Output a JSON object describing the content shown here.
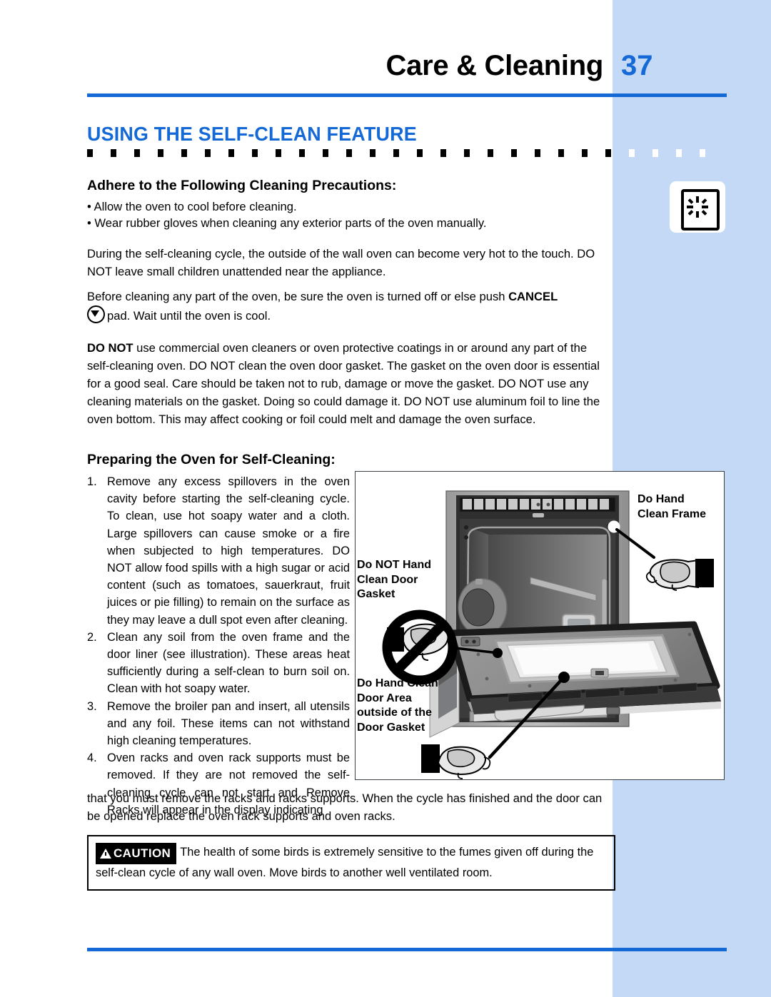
{
  "colors": {
    "accent_blue": "#1569d6",
    "band_blue": "#c4d9f5",
    "text_black": "#000000"
  },
  "header": {
    "title": "Care & Cleaning",
    "page_number": "37"
  },
  "section": {
    "heading": "USING THE SELF-CLEAN FEATURE"
  },
  "precautions": {
    "heading": "Adhere to the Following Cleaning Precautions:",
    "bullets": [
      "• Allow the oven to cool before cleaning.",
      "• Wear rubber gloves when cleaning any exterior parts of the oven manually."
    ]
  },
  "paragraphs": {
    "hot_surface": "During the self-cleaning cycle, the outside of the wall oven can become very hot to the touch. DO NOT leave small children unattended near the appliance.",
    "before_cleaning_lead": "Before cleaning any part of the oven, be sure the oven is turned off or else push ",
    "before_cleaning_bold": "CANCEL",
    "before_cleaning_tail": "pad. Wait until the oven is cool.",
    "do_not_bold": "DO NOT",
    "do_not_rest": " use commercial oven cleaners or oven protective coatings in or around any part of the self-cleaning oven. DO NOT clean the oven door gasket. The gasket on the oven door is essential for a good seal. Care should be taken not to rub, damage or move the gasket. DO NOT use any cleaning materials on the gasket. Doing so could damage it. DO NOT use aluminum foil to line the oven bottom. This may affect cooking or foil could melt and damage the oven surface."
  },
  "preparing": {
    "heading": "Preparing the Oven for Self-Cleaning:",
    "steps": [
      {
        "num": "1.",
        "text": "Remove any excess spillovers in the oven cavity before starting the self-cleaning cycle. To clean, use hot soapy water and a cloth. Large spillovers can cause smoke or a fire when subjected to high temperatures. DO NOT allow food spills with a high sugar or acid content (such as tomatoes, sauerkraut, fruit juices or pie filling) to remain on the surface as they may leave a dull spot even after cleaning."
      },
      {
        "num": "2.",
        "text": "Clean any soil from the oven frame and the door liner (see illustration). These areas heat sufficiently during a self-clean to burn soil on. Clean with hot soapy water."
      },
      {
        "num": "3.",
        "text": "Remove the broiler pan and insert, all utensils and any foil. These items can not withstand high cleaning temperatures."
      },
      {
        "num": "4.",
        "text": "Oven racks and oven rack supports must be removed. If they are not removed the self-cleaning cycle can not start and Remove Racks will appear in the display indicating"
      }
    ],
    "tail": "that you must remove the racks and racks supports. When the cycle has finished and the door can be opened replace the oven rack supports and oven racks."
  },
  "caution": {
    "badge": "CAUTION",
    "text": "The health of some birds is extremely sensitive to the fumes given off during the self-clean cycle of any wall oven. Move birds to another well ventilated room."
  },
  "illustration": {
    "labels": {
      "frame": "Do Hand\nClean Frame",
      "no_hand_gasket": "Do NOT Hand\nClean Door\nGasket",
      "door_area": "Do Hand Clean\nDoor Area\noutside of the\nDoor Gasket"
    }
  },
  "icons": {
    "selfclean_key": "self-clean-burst-icon",
    "cancel_pad": "cancel-pad-icon"
  }
}
